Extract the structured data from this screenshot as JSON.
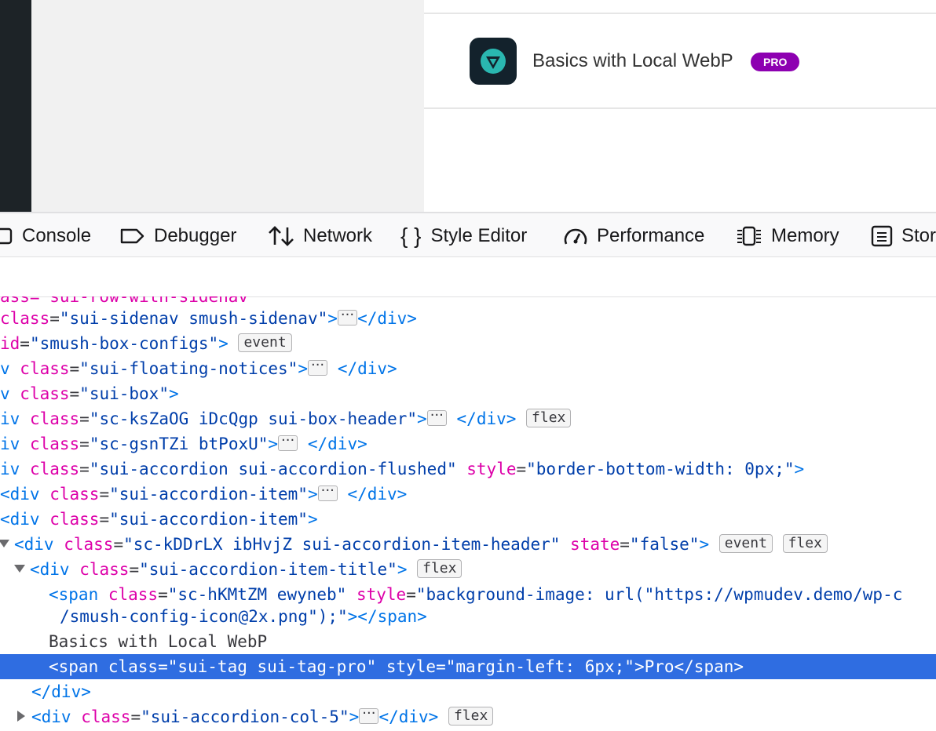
{
  "page": {
    "config_title": "Basics with Local WebP",
    "pro_tag": "PRO"
  },
  "devtools": {
    "tabs": [
      "Console",
      "Debugger",
      "Network",
      "Style Editor",
      "Performance",
      "Memory",
      "Stor"
    ]
  },
  "markup": {
    "cut_row": "ass=\"sui-row-with-sidenav\"",
    "r1": {
      "a": "class",
      "v": "\"sui-sidenav smush-sidenav\"",
      "close": "</div>"
    },
    "r2": {
      "a": "id",
      "v": "\"smush-box-configs\"",
      "badge": "event"
    },
    "r3": {
      "a": "class",
      "v": "\"sui-floating-notices\"",
      "close": "</div>"
    },
    "r4": {
      "a": "class",
      "v": "\"sui-box\""
    },
    "r5": {
      "a": "class",
      "v": "\"sc-ksZaOG iDcQgp sui-box-header\"",
      "close": "</div>",
      "badge": "flex"
    },
    "r6": {
      "a": "class",
      "v": "\"sc-gsnTZi btPoxU\"",
      "close": "</div>"
    },
    "r7": {
      "a": "class",
      "v": "\"sui-accordion sui-accordion-flushed\"",
      "a2": "style",
      "v2": "\"border-bottom-width: 0px;\""
    },
    "r8": {
      "a": "class",
      "v": "\"sui-accordion-item\"",
      "close": "</div>"
    },
    "r9": {
      "a": "class",
      "v": "\"sui-accordion-item\""
    },
    "r10": {
      "a": "class",
      "v": "\"sc-kDDrLX ibHvjZ sui-accordion-item-header\"",
      "a2": "state",
      "v2": "\"false\"",
      "badge": "event",
      "badge2": "flex"
    },
    "r11": {
      "a": "class",
      "v": "\"sui-accordion-item-title\"",
      "badge": "flex"
    },
    "r12": {
      "a": "class",
      "v": "\"sc-hKMtZM ewyneb\"",
      "a2": "style",
      "v2": "\"background-image: url(\"https://wpmudev.demo/wp-c"
    },
    "r13": {
      "text": "/smush-config-icon@2x.png\");\"",
      "close": "></span>"
    },
    "r14": {
      "text": "Basics with Local WebP"
    },
    "r15": {
      "line": "<span class=\"sui-tag sui-tag-pro\" style=\"margin-left: 6px;\">Pro</span>"
    },
    "r16": {
      "close": "</div>"
    },
    "r17": {
      "a": "class",
      "v": "\"sui-accordion-col-5\"",
      "close": "</div>",
      "badge": "flex"
    }
  },
  "colors": {
    "pro_tag": "#8d00b1",
    "selection": "#2f6de1",
    "tag_name": "#0074e8",
    "attr_name": "#dd00a9",
    "attr_value": "#003eaa"
  }
}
